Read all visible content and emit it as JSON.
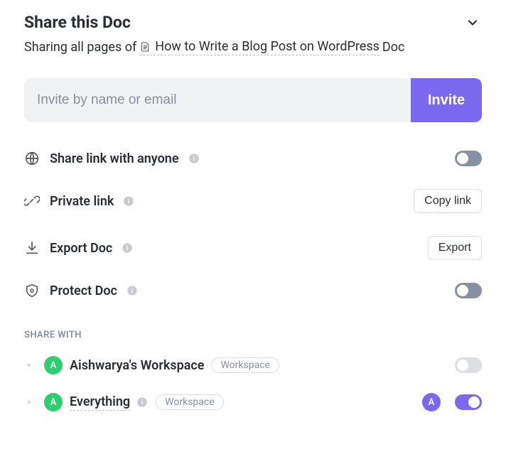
{
  "header": {
    "title": "Share this Doc",
    "subtitle_prefix": "Sharing all pages of",
    "doc_name": "How to Write a Blog Post on WordPress",
    "subtitle_suffix": "Doc"
  },
  "invite": {
    "placeholder": "Invite by name or email",
    "button": "Invite"
  },
  "options": {
    "share_link": {
      "label": "Share link with anyone",
      "toggle": "off-dark"
    },
    "private_link": {
      "label": "Private link",
      "button": "Copy link"
    },
    "export": {
      "label": "Export Doc",
      "button": "Export"
    },
    "protect": {
      "label": "Protect Doc",
      "toggle": "off-dark"
    }
  },
  "share_with": {
    "heading": "SHARE WITH",
    "items": [
      {
        "avatar_letter": "A",
        "avatar_color": "green",
        "name": "Aishwarya's Workspace",
        "badge": "Workspace",
        "name_dashed": false,
        "has_info": false,
        "extra_avatar": null,
        "toggle": "off-light"
      },
      {
        "avatar_letter": "A",
        "avatar_color": "green",
        "name": "Everything",
        "badge": "Workspace",
        "name_dashed": true,
        "has_info": true,
        "extra_avatar": {
          "letter": "A",
          "color": "purple"
        },
        "toggle": "on"
      }
    ]
  }
}
